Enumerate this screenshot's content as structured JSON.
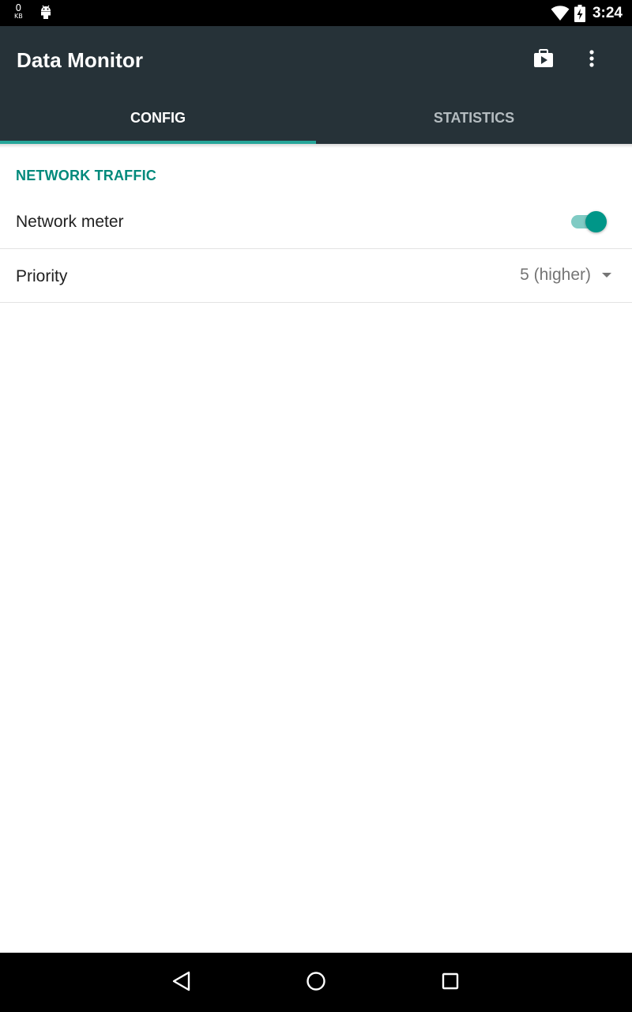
{
  "status_bar": {
    "data_counter_value": "0",
    "data_counter_unit": "KB",
    "time": "3:24",
    "icons": [
      "android-icon",
      "wifi-icon",
      "battery-charging-icon"
    ]
  },
  "app_bar": {
    "title": "Data Monitor",
    "actions": [
      "play-store-icon",
      "more-vert-icon"
    ],
    "background_color": "#263238"
  },
  "tabs": [
    {
      "label": "CONFIG",
      "active": true
    },
    {
      "label": "STATISTICS",
      "active": false
    }
  ],
  "accent_color": "#009688",
  "settings": {
    "section_title": "NETWORK TRAFFIC",
    "network_meter": {
      "label": "Network meter",
      "enabled": true
    },
    "priority": {
      "label": "Priority",
      "value": "5 (higher)"
    }
  },
  "nav_bar": {
    "buttons": [
      "back-icon",
      "home-icon",
      "recents-icon"
    ]
  }
}
